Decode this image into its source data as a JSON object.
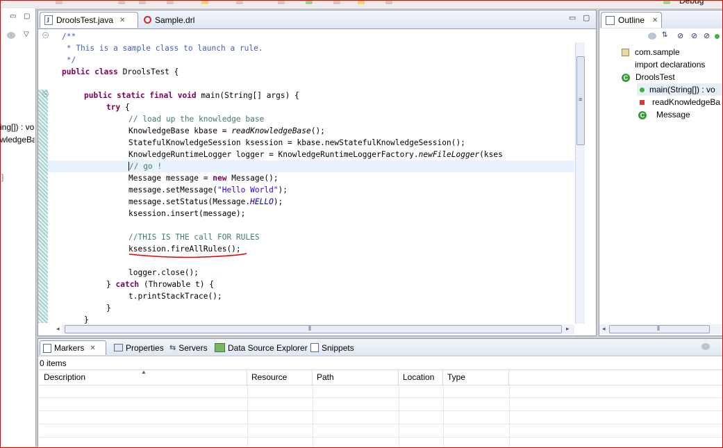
{
  "toolbar": {
    "debug_label": "Debug"
  },
  "left_panel": {
    "lines": [
      {
        "text": "ing[]) : vo"
      },
      {
        "text": "wledgeBa"
      },
      {
        "text": "]"
      }
    ]
  },
  "editor": {
    "tabs": [
      {
        "label": "DroolsTest.java",
        "close": "✕",
        "active": true
      },
      {
        "label": "Sample.drl"
      }
    ],
    "code": {
      "l01": "/**",
      "l02": " * This is a sample class to launch a rule.",
      "l03": " */",
      "l04a": "public class",
      "l04b": " DroolsTest {",
      "l06a": "public static final void",
      "l06b": " main(String[] args) {",
      "l07a": "try",
      "l07b": " {",
      "l08": "// load up the knowledge base",
      "l09a": "KnowledgeBase kbase = ",
      "l09b": "readKnowledgeBase",
      "l09c": "();",
      "l10": "StatefulKnowledgeSession ksession = kbase.newStatefulKnowledgeSession();",
      "l11a": "KnowledgeRuntimeLogger logger = KnowledgeRuntimeLoggerFactory.",
      "l11b": "newFileLogger",
      "l11c": "(kses",
      "l12": "// go !",
      "l13a": "Message message = ",
      "l13b": "new",
      "l13c": " Message();",
      "l14a": "message.setMessage(",
      "l14b": "\"Hello World\"",
      "l14c": ");",
      "l15a": "message.setStatus(Message.",
      "l15b": "HELLO",
      "l15c": ");",
      "l16": "ksession.insert(message);",
      "l18": "//THIS IS THE call FOR RULES",
      "l19": "ksession.fireAllRules();",
      "l21": "logger.close();",
      "l22a": "} ",
      "l22b": "catch",
      "l22c": " (Throwable t) {",
      "l23": "t.printStackTrace();",
      "l24": "}",
      "l25": "}"
    }
  },
  "outline": {
    "title": "Outline",
    "close": "✕",
    "items": [
      {
        "label": "com.sample"
      },
      {
        "label": "import declarations"
      },
      {
        "label": "DroolsTest"
      },
      {
        "label": "main(String[]) : vo"
      },
      {
        "label": "readKnowledgeBa"
      },
      {
        "label": "Message"
      }
    ]
  },
  "markers_view": {
    "tabs": [
      {
        "label": "Markers",
        "close": "✕"
      },
      {
        "label": "Properties"
      },
      {
        "label": "Servers"
      },
      {
        "label": "Data Source Explorer"
      },
      {
        "label": "Snippets"
      }
    ],
    "items_count": "0 items",
    "columns": [
      "Description",
      "Resource",
      "Path",
      "Location",
      "Type"
    ]
  },
  "colors": {
    "annotation_red": "#e00000",
    "keyword": "#7f0055",
    "comment": "#3f7f5f",
    "javadoc": "#3f5fbf",
    "string": "#2a00ff"
  }
}
